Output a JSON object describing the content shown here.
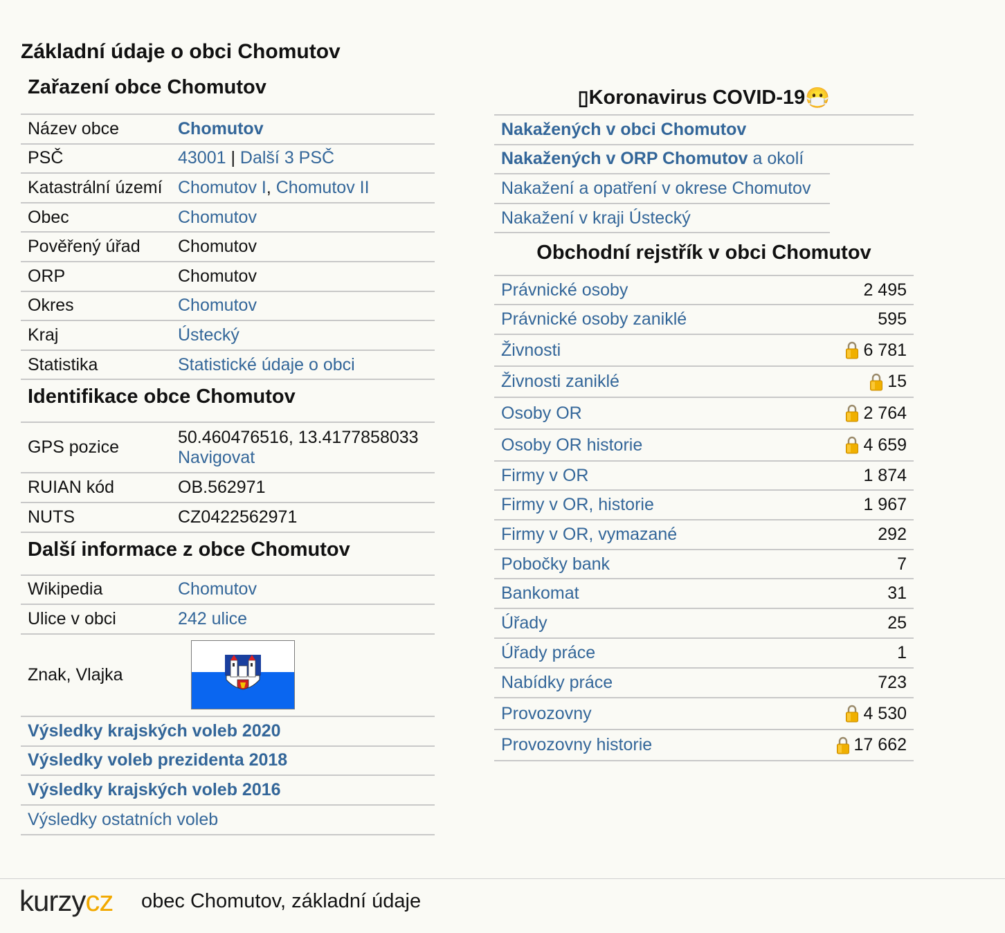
{
  "title": "Základní údaje o obci Chomutov",
  "classification": {
    "heading": "Zařazení obce Chomutov",
    "rows": [
      {
        "key": "Název obce",
        "value": "Chomutov"
      },
      {
        "key": "PSČ",
        "value": "43001",
        "sep": " | ",
        "value2": "Další 3 PSČ"
      },
      {
        "key": "Katastrální území",
        "value": "Chomutov I",
        "sep": ", ",
        "value2": "Chomutov II"
      },
      {
        "key": "Obec",
        "value": "Chomutov"
      },
      {
        "key": "Pověřený úřad",
        "value": "Chomutov"
      },
      {
        "key": "ORP",
        "value": "Chomutov"
      },
      {
        "key": "Okres",
        "value": "Chomutov"
      },
      {
        "key": "Kraj",
        "value": "Ústecký"
      },
      {
        "key": "Statistika",
        "value": "Statistické údaje o obci"
      }
    ]
  },
  "identification": {
    "heading": "Identifikace obce Chomutov",
    "gps_key": "GPS pozice",
    "gps_value": "50.460476516, 13.4177858033",
    "gps_link": "Navigovat",
    "ruian_key": "RUIAN kód",
    "ruian_value": "OB.562971",
    "nuts_key": "NUTS",
    "nuts_value": "CZ0422562971"
  },
  "more_info": {
    "heading": "Další informace z obce Chomutov",
    "wiki_key": "Wikipedia",
    "wiki_value": "Chomutov",
    "streets_key": "Ulice v obci",
    "streets_value": "242 ulice",
    "flag_key": "Znak, Vlajka"
  },
  "elections": [
    "Výsledky krajských voleb 2020",
    "Výsledky voleb prezidenta 2018",
    "Výsledky krajských voleb 2016",
    "Výsledky ostatních voleb"
  ],
  "covid": {
    "heading_prefix": "▯ ",
    "heading": "Koronavirus COVID-19",
    "heading_suffix": " 😷",
    "link1": "Nakažených v obci Chomutov",
    "link2_bold": "Nakažených v ORP Chomutov",
    "link2_rest": " a okolí",
    "link3": "Nakažení a opatření v okrese Chomutov",
    "link4": "Nakažení v kraji Ústecký"
  },
  "register": {
    "heading": "Obchodní rejstřík v obci Chomutov",
    "rows": [
      {
        "label": "Právnické osoby",
        "value": "2 495",
        "locked": false
      },
      {
        "label": "Právnické osoby zaniklé",
        "value": "595",
        "locked": false
      },
      {
        "label": "Živnosti",
        "value": "6 781",
        "locked": true
      },
      {
        "label": "Živnosti zaniklé",
        "value": "15",
        "locked": true
      },
      {
        "label": "Osoby OR",
        "value": "2 764",
        "locked": true
      },
      {
        "label": "Osoby OR historie",
        "value": "4 659",
        "locked": true
      },
      {
        "label": "Firmy v OR",
        "value": "1 874",
        "locked": false
      },
      {
        "label": "Firmy v OR, historie",
        "value": "1 967",
        "locked": false
      },
      {
        "label": "Firmy v OR, vymazané",
        "value": "292",
        "locked": false
      },
      {
        "label": "Pobočky bank",
        "value": "7",
        "locked": false
      },
      {
        "label": "Bankomat",
        "value": "31",
        "locked": false
      },
      {
        "label": "Úřady",
        "value": "25",
        "locked": false
      },
      {
        "label": "Úřady práce",
        "value": "1",
        "locked": false
      },
      {
        "label": "Nabídky práce",
        "value": "723",
        "locked": false
      },
      {
        "label": "Provozovny",
        "value": "4 530",
        "locked": true
      },
      {
        "label": "Provozovny historie",
        "value": "17 662",
        "locked": true
      }
    ]
  },
  "footer": {
    "logo_dark": "kurzy",
    "logo_accent": "cz",
    "text": "obec Chomutov, základní údaje"
  },
  "colors": {
    "link": "#336699",
    "background": "#fafaf5",
    "border": "#c8c8c8",
    "logo_accent": "#f2a900"
  }
}
